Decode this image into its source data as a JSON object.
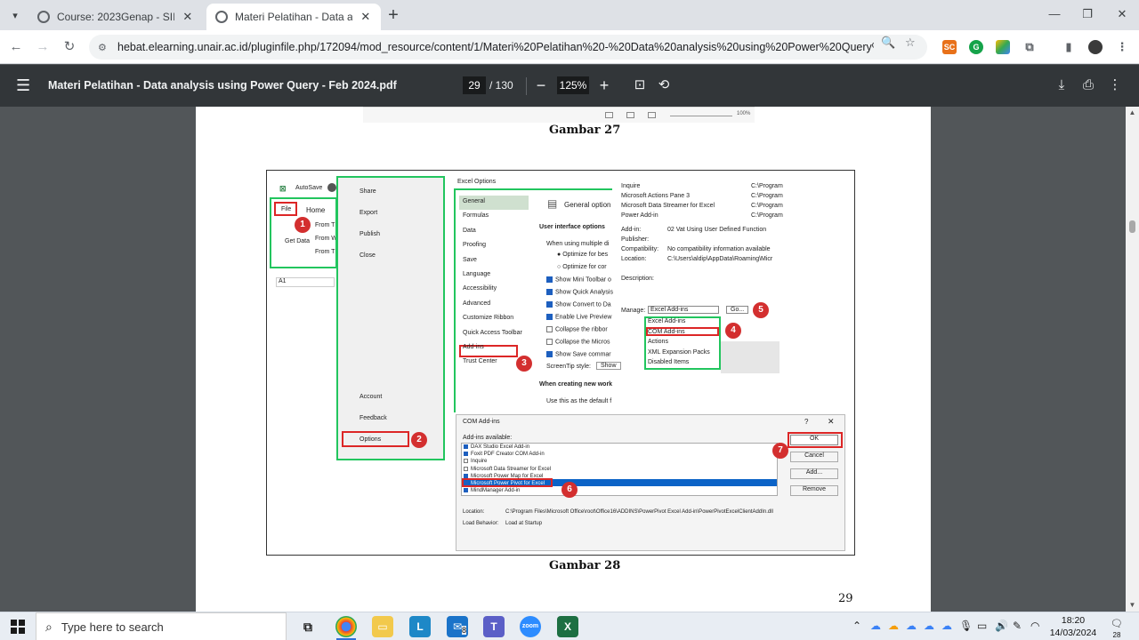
{
  "browser": {
    "tabs": [
      {
        "title": "Course: 2023Genap - SII324 - D",
        "active": false
      },
      {
        "title": "Materi Pelatihan - Data analysis",
        "active": true
      }
    ],
    "url": "hebat.elearning.unair.ac.id/pluginfile.php/172094/mod_resource/content/1/Materi%20Pelatihan%20-%20Data%20analysis%20using%20Power%20Query%20-%20Fe...",
    "extensions": [
      "SC",
      "G",
      "drive",
      "puzzle"
    ]
  },
  "pdf": {
    "filename": "Materi Pelatihan - Data analysis using Power Query - Feb 2024.pdf",
    "current_page": "29",
    "total_pages": "/ 130",
    "zoom": "125%"
  },
  "document": {
    "caption_top": "Gambar 27",
    "caption_bottom": "Gambar 28",
    "page_number": "29",
    "prev_zoom": "100%"
  },
  "figure": {
    "excel_left": {
      "autosave": "AutoSave",
      "file": "File",
      "home": "Home",
      "get_data": "Get Data",
      "from_1": "From T",
      "from_2": "From W",
      "from_3": "From T",
      "cell_ref": "A1"
    },
    "file_menu": [
      "Share",
      "Export",
      "Publish",
      "Close"
    ],
    "file_menu_bottom": [
      "Account",
      "Feedback",
      "Options"
    ],
    "options_dialog": {
      "title": "Excel Options",
      "nav": [
        "General",
        "Formulas",
        "Data",
        "Proofing",
        "Save",
        "Language",
        "Accessibility",
        "Advanced",
        "Customize Ribbon",
        "Quick Access Toolbar",
        "Add-ins",
        "Trust Center"
      ],
      "heading": "General option",
      "section1": "User interface options",
      "opt_multiple": "When using multiple di",
      "radio1": "Optimize for bes",
      "radio2": "Optimize for cor",
      "checks": [
        "Show Mini Toolbar o",
        "Show Quick Analysis",
        "Show Convert to Da",
        "Enable Live Preview",
        "Collapse the ribbor",
        "Collapse the Micros",
        "Show Save commar"
      ],
      "screentip": "ScreenTip style:",
      "screentip_val": "Show",
      "section2": "When creating new work",
      "default_font": "Use this as the default f"
    },
    "addins_panel": {
      "rows": [
        "Inquire",
        "Microsoft Actions Pane 3",
        "Microsoft Data Streamer for Excel",
        "Power Add-in"
      ],
      "paths": [
        "C:\\Program",
        "C:\\Program",
        "C:\\Program",
        "C:\\Program"
      ],
      "addin_label": "Add-in:",
      "addin_val": "02 Vat Using User Defined Function",
      "publisher": "Publisher:",
      "compat": "Compatibility:",
      "compat_val": "No compatibility information available",
      "location": "Location:",
      "location_val": "C:\\Users\\aldip\\AppData\\Roaming\\Micr",
      "description": "Description:",
      "manage": "Manage:",
      "manage_val": "Excel Add-ins",
      "go": "Go...",
      "dropdown": [
        "Excel Add-ins",
        "COM Add-ins",
        "Actions",
        "XML Expansion Packs",
        "Disabled Items"
      ]
    },
    "com_dialog": {
      "title": "COM Add-ins",
      "available": "Add-ins available:",
      "items": [
        {
          "label": "DAX Studio Excel Add-in",
          "checked": true
        },
        {
          "label": "Foxit PDF Creator COM Add-in",
          "checked": true
        },
        {
          "label": "Inquire",
          "checked": false
        },
        {
          "label": "Microsoft Data Streamer for Excel",
          "checked": false
        },
        {
          "label": "Microsoft Power Map for Excel",
          "checked": true
        },
        {
          "label": "Microsoft Power Pivot for Excel",
          "checked": true
        },
        {
          "label": "MindManager Add-in",
          "checked": true
        }
      ],
      "ok": "OK",
      "cancel": "Cancel",
      "add": "Add...",
      "remove": "Remove",
      "location_label": "Location:",
      "location_val": "C:\\Program Files\\Microsoft Office\\root\\Office16\\ADDINS\\PowerPivot Excel Add-in\\PowerPivotExcelClientAddIn.dll",
      "load_label": "Load Behavior:",
      "load_val": "Load at Startup"
    },
    "badges": [
      "1",
      "2",
      "3",
      "4",
      "5",
      "6",
      "7"
    ]
  },
  "taskbar": {
    "search_placeholder": "Type here to search",
    "mail_badge": "8",
    "time": "18:20",
    "date": "14/03/2024",
    "notifications": "28"
  },
  "colors": {
    "highlight_green": "#22c55e",
    "highlight_red": "#dc2626",
    "badge_red": "#d32f2f",
    "pdf_toolbar": "#323639",
    "viewer_bg": "#525659"
  }
}
